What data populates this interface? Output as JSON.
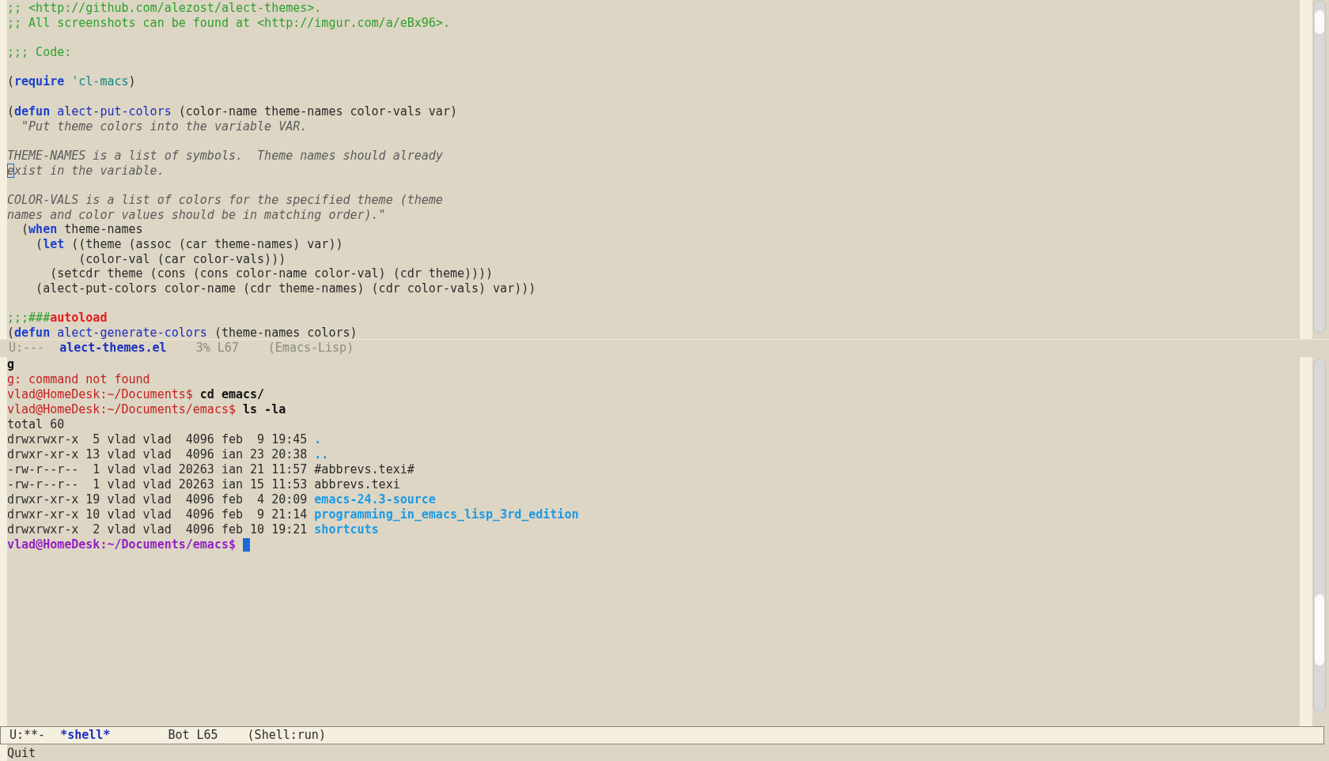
{
  "code_window": {
    "blocks": [
      {
        "lines": [
          [
            {
              "kind": "comment",
              "text": ";; <http://github.com/alezost/alect-themes>."
            }
          ],
          [
            {
              "kind": "comment",
              "text": ";; All screenshots can be found at <http://imgur.com/a/eBx96>."
            }
          ]
        ]
      },
      {
        "lines": [
          [
            {
              "kind": "comment",
              "text": ";;; Code:"
            }
          ]
        ]
      },
      {
        "lines": [
          [
            {
              "kind": "plain",
              "text": "("
            },
            {
              "kind": "keyword",
              "text": "require"
            },
            {
              "kind": "constant",
              "text": " 'cl-macs"
            },
            {
              "kind": "plain",
              "text": ")"
            }
          ]
        ]
      },
      {
        "lines": [
          [
            {
              "kind": "plain",
              "text": "("
            },
            {
              "kind": "keyword",
              "text": "defun"
            },
            {
              "kind": "function",
              "text": " alect-put-colors"
            },
            {
              "kind": "plain",
              "text": " (color-name theme-names color-vals var)"
            }
          ],
          [
            {
              "kind": "doc",
              "text": "  \"Put theme colors into the variable VAR."
            }
          ]
        ]
      },
      {
        "lines": [
          [
            {
              "kind": "doc",
              "text": "THEME-NAMES is a list of symbols.  Theme names should already"
            }
          ],
          [
            {
              "kind": "cursor",
              "text": "e"
            },
            {
              "kind": "doc",
              "text": "xist in the variable."
            }
          ]
        ]
      },
      {
        "lines": [
          [
            {
              "kind": "doc",
              "text": "COLOR-VALS is a list of colors for the specified theme (theme"
            }
          ],
          [
            {
              "kind": "doc",
              "text": "names and color values should be in matching order).\""
            }
          ],
          [
            {
              "kind": "plain",
              "text": "  ("
            },
            {
              "kind": "keyword",
              "text": "when"
            },
            {
              "kind": "plain",
              "text": " theme-names"
            }
          ],
          [
            {
              "kind": "plain",
              "text": "    ("
            },
            {
              "kind": "keyword",
              "text": "let"
            },
            {
              "kind": "plain",
              "text": " ((theme (assoc (car theme-names) var))"
            }
          ],
          [
            {
              "kind": "plain",
              "text": "          (color-val (car color-vals)))"
            }
          ],
          [
            {
              "kind": "plain",
              "text": "      (setcdr theme (cons (cons color-name color-val) (cdr theme))))"
            }
          ],
          [
            {
              "kind": "plain",
              "text": "    (alect-put-colors color-name (cdr theme-names) (cdr color-vals) var)))"
            }
          ]
        ]
      },
      {
        "lines": [
          [
            {
              "kind": "comment",
              "text": ";;;###"
            },
            {
              "kind": "warning",
              "text": "autoload"
            }
          ],
          [
            {
              "kind": "plain",
              "text": "("
            },
            {
              "kind": "keyword",
              "text": "defun"
            },
            {
              "kind": "function",
              "text": " alect-generate-colors"
            },
            {
              "kind": "plain",
              "text": " (theme-names colors)"
            }
          ]
        ]
      }
    ]
  },
  "code_mode_line": {
    "status": "U:---",
    "buffer": "alect-themes.el",
    "position": "3% L67",
    "mode": "(Emacs-Lisp)"
  },
  "shell_window": {
    "lines": [
      [
        {
          "kind": "command",
          "text": "g"
        }
      ],
      [
        {
          "kind": "error",
          "text": "g: command not found"
        }
      ],
      [
        {
          "kind": "prompt",
          "text": "vlad@HomeDesk:~/Documents$"
        },
        {
          "kind": "command",
          "text": " cd emacs/"
        }
      ],
      [
        {
          "kind": "prompt",
          "text": "vlad@HomeDesk:~/Documents/emacs$"
        },
        {
          "kind": "command",
          "text": " ls -la"
        }
      ],
      [
        {
          "kind": "plain",
          "text": "total 60"
        }
      ],
      [
        {
          "kind": "plain",
          "text": "drwxrwxr-x  5 vlad vlad  4096 feb  9 19:45 "
        },
        {
          "kind": "dir",
          "text": "."
        }
      ],
      [
        {
          "kind": "plain",
          "text": "drwxr-xr-x 13 vlad vlad  4096 ian 23 20:38 "
        },
        {
          "kind": "dir",
          "text": ".."
        }
      ],
      [
        {
          "kind": "plain",
          "text": "-rw-r--r--  1 vlad vlad 20263 ian 21 11:57 #abbrevs.texi#"
        }
      ],
      [
        {
          "kind": "plain",
          "text": "-rw-r--r--  1 vlad vlad 20263 ian 15 11:53 abbrevs.texi"
        }
      ],
      [
        {
          "kind": "plain",
          "text": "drwxr-xr-x 19 vlad vlad  4096 feb  4 20:09 "
        },
        {
          "kind": "dir",
          "text": "emacs-24.3-source"
        }
      ],
      [
        {
          "kind": "plain",
          "text": "drwxr-xr-x 10 vlad vlad  4096 feb  9 21:14 "
        },
        {
          "kind": "dir",
          "text": "programming_in_emacs_lisp_3rd_edition"
        }
      ],
      [
        {
          "kind": "plain",
          "text": "drwxrwxr-x  2 vlad vlad  4096 feb 10 19:21 "
        },
        {
          "kind": "dir",
          "text": "shortcuts"
        }
      ],
      [
        {
          "kind": "last-prompt",
          "text": "vlad@HomeDesk:~/Documents/emacs$"
        }
      ]
    ]
  },
  "shell_mode_line": {
    "status": "U:**-",
    "buffer": "*shell*",
    "position": "Bot L65",
    "mode": "(Shell:run)"
  },
  "minibuffer": {
    "message": "Quit"
  }
}
